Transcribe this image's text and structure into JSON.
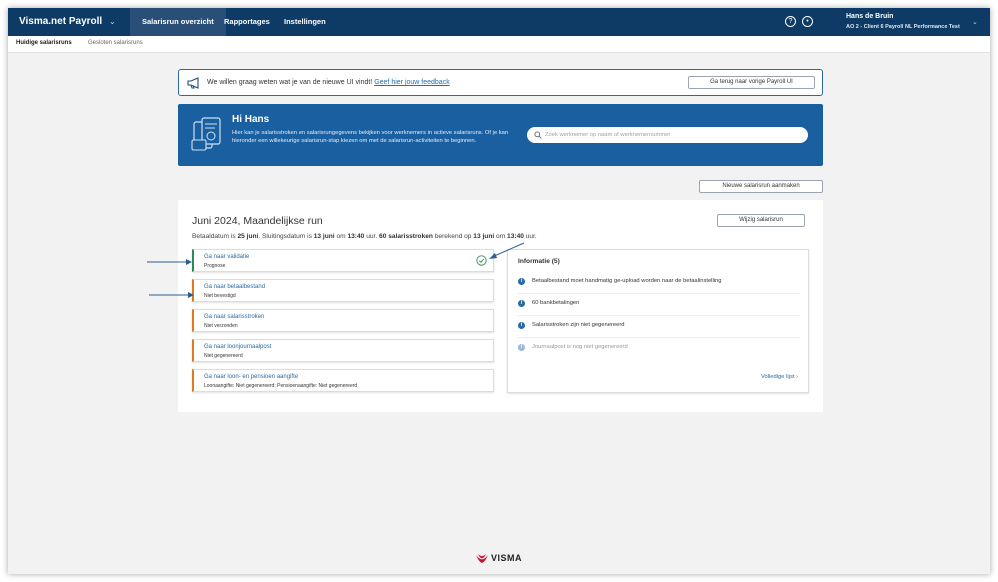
{
  "topbar": {
    "brand": "Visma.net Payroll",
    "nav": [
      "Salarisrun overzicht",
      "Rapportages",
      "Instellingen"
    ],
    "user_name": "Hans de Bruin",
    "user_company": "AO 2 - Client 6 Payroll NL Performance Test"
  },
  "subnav": {
    "items": [
      "Huidige salarisruns",
      "Gesloten salarisruns"
    ]
  },
  "feedback": {
    "text": "We willen graag weten wat je van de nieuwe UI vindt!",
    "link": "Geef hier jouw feedback",
    "back_button": "Ga terug naar vorige Payroll UI"
  },
  "hero": {
    "title": "Hi Hans",
    "text": "Hier kan je salarisstroken en salarisrungegevens bekijken voor werknemers in actieve salarisruns. Of je kan hieronder een willekeurige salarisrun-stap kiezen om met de salarisrun-activiteiten te beginnen.",
    "search_placeholder": "Zoek werknemer op naam of werknemernummer"
  },
  "new_run_button": "Nieuwe salarisrun aanmaken",
  "run": {
    "title": "Juni 2024, Maandelijkse run",
    "edit_button": "Wijzig salarisrun",
    "meta": {
      "pay_label": "Betaaldatum is",
      "pay_date": "25 juni",
      "close_label": ". Sluitingsdatum is",
      "close_date": "13 juni",
      "close_at": "om",
      "close_time": "13:40",
      "close_unit": "uur.",
      "slips_count": "60",
      "slips_label": "salarisstroken",
      "calc_label": "berekend op",
      "calc_date": "13 juni",
      "calc_at": "om",
      "calc_time": "13:40",
      "calc_unit": "uur."
    },
    "steps": [
      {
        "link": "Ga naar validatie",
        "status": "Prognose",
        "done": true
      },
      {
        "link": "Ga naar betaalbestand",
        "status": "Niet bevestigd",
        "done": false
      },
      {
        "link": "Ga naar salarisstroken",
        "status": "Niet verzonden",
        "done": false
      },
      {
        "link": "Ga naar loonjournaalpost",
        "status": "Niet gegenereerd",
        "done": false
      },
      {
        "link": "Ga naar loon- en pensioen aangifte",
        "status": "Loonaangifte: Niet gegenereerd; Pensioenaangifte: Niet gegenereerd",
        "done": false
      }
    ],
    "info": {
      "title": "Informatie (5)",
      "items": [
        "Betaalbestand moet handmatig ge-upload worden naar de betaalinstelling",
        "60 bankbetalingen",
        "Salarisstroken zijn niet gegenereerd",
        "Journaalpost is nog niet gegenereerd"
      ],
      "more": "Volledige lijst ›"
    }
  },
  "footer": {
    "logo": "VISMA"
  },
  "colors": {
    "nav_bg": "#0d3b66",
    "hero_bg": "#1a5fa0",
    "accent": "#2b6aa0",
    "step_pending": "#e07a1f",
    "step_done": "#2e8b57",
    "logo_red": "#c8102e"
  }
}
